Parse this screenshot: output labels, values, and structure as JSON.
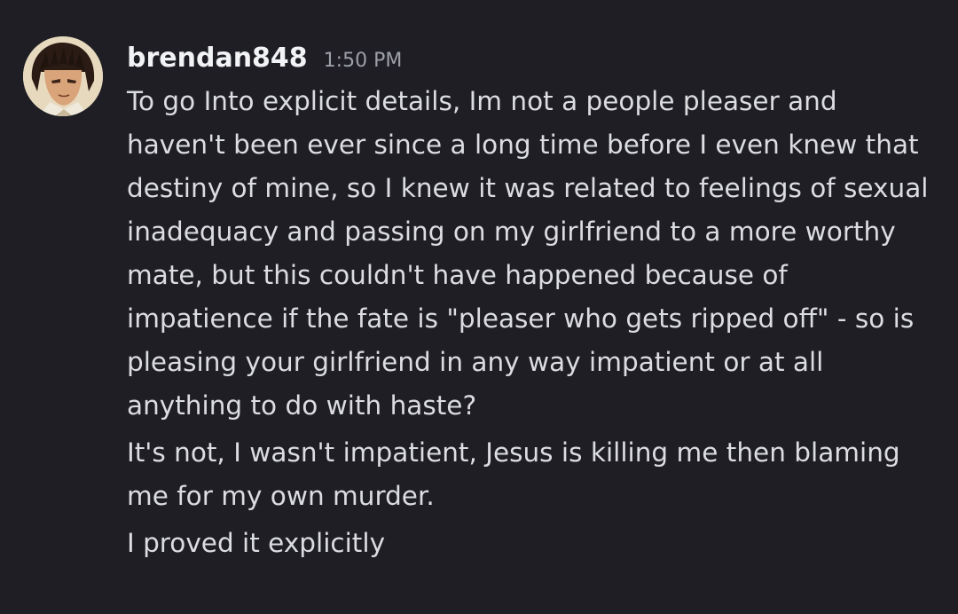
{
  "message_group": {
    "author": {
      "username": "brendan848",
      "timestamp": "1:50 PM",
      "avatar_icon": "anime-character-avatar"
    },
    "messages": [
      {
        "lines": [
          "To go Into explicit details, Im not a people pleaser and",
          "haven't been ever since a long time before I even knew that",
          "destiny of mine, so I knew it was related to feelings of sexual",
          "inadequacy and passing on my girlfriend to a more worthy",
          "mate, but this couldn't have happened because of",
          "impatience if the fate is \"pleaser who gets ripped off\" - so is",
          "pleasing your girlfriend in any way impatient or at all",
          "anything to do with haste?"
        ]
      },
      {
        "lines": [
          "It's not, I wasn't impatient, Jesus is killing me then blaming",
          "me for my own murder."
        ]
      },
      {
        "lines": [
          "I proved it explicitly"
        ]
      }
    ]
  },
  "colors": {
    "background": "#1e1e24",
    "username": "#f2f3f5",
    "timestamp": "#9ea0a8",
    "message_text": "#dcdde1"
  }
}
